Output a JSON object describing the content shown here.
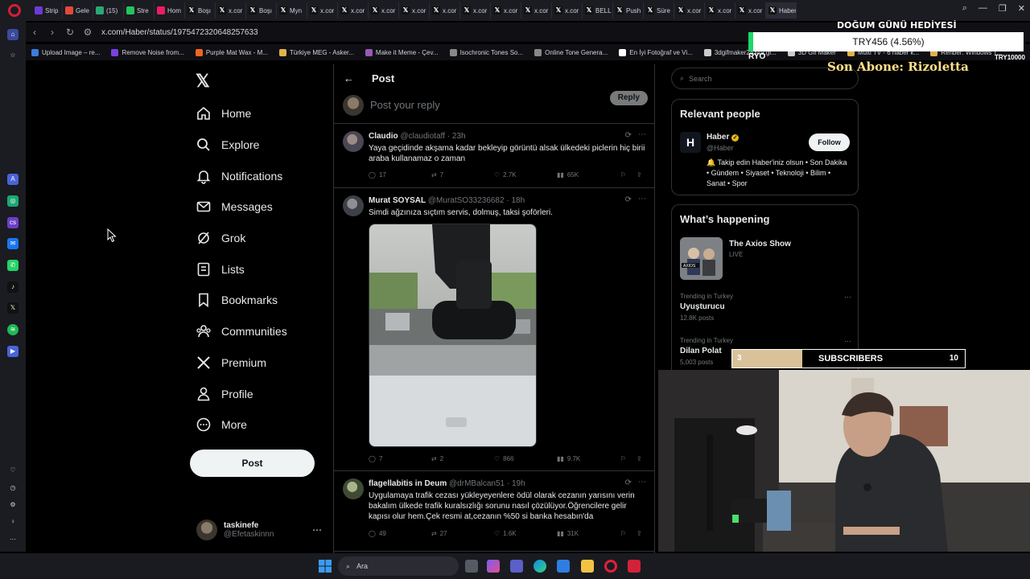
{
  "browser": {
    "tabs": [
      {
        "label": "Strip",
        "color": "#6c3bd6"
      },
      {
        "label": "Gele",
        "color": "#e3493a"
      },
      {
        "label": "(15)",
        "color": "#2aa876"
      },
      {
        "label": "Stre",
        "color": "#22c55e"
      },
      {
        "label": "Hom",
        "color": "#e91e63"
      },
      {
        "label": "Boşı",
        "color": "#111111"
      },
      {
        "label": "x.cor",
        "color": "#111111"
      },
      {
        "label": "Boşı",
        "color": "#111111"
      },
      {
        "label": "Myn",
        "color": "#111111"
      },
      {
        "label": "x.cor",
        "color": "#111111"
      },
      {
        "label": "x.cor",
        "color": "#111111"
      },
      {
        "label": "x.cor",
        "color": "#111111"
      },
      {
        "label": "x.cor",
        "color": "#111111"
      },
      {
        "label": "x.cor",
        "color": "#111111"
      },
      {
        "label": "x.cor",
        "color": "#111111"
      },
      {
        "label": "x.cor",
        "color": "#111111"
      },
      {
        "label": "x.cor",
        "color": "#111111"
      },
      {
        "label": "x.cor",
        "color": "#111111"
      },
      {
        "label": "BELL",
        "color": "#111111"
      },
      {
        "label": "Push",
        "color": "#111111"
      },
      {
        "label": "Süre",
        "color": "#111111"
      },
      {
        "label": "x.cor",
        "color": "#111111"
      },
      {
        "label": "x.cor",
        "color": "#111111"
      },
      {
        "label": "x.cor",
        "color": "#111111"
      },
      {
        "label": "Haber o",
        "color": "#111111"
      }
    ],
    "url": "x.com/Haber/status/1975472320648257633",
    "bookmarks": [
      {
        "label": "Upload Image – re...",
        "color": "#3d7be0"
      },
      {
        "label": "Remove Noise from...",
        "color": "#7b3fe4"
      },
      {
        "label": "Purple Mat Wax - M...",
        "color": "#f26522"
      },
      {
        "label": "Türkiye MEG - Asker...",
        "color": "#e0b34a"
      },
      {
        "label": "Make it Meme - Çev...",
        "color": "#9b59b6"
      },
      {
        "label": "Isochronic Tones So...",
        "color": "#888888"
      },
      {
        "label": "Online Tone Genera...",
        "color": "#888888"
      },
      {
        "label": "En İyi Fotoğraf ve Vi...",
        "color": "#ffffff"
      },
      {
        "label": "3dgifmaker28349.gi...",
        "color": "#cccccc"
      },
      {
        "label": "3D Gif Maker",
        "color": "#cccccc"
      },
      {
        "label": "Multi TV - 6 haber k...",
        "color": "#e0b34a"
      },
      {
        "label": "Rehber: Windows T...",
        "color": "#e0b34a"
      }
    ]
  },
  "nav": {
    "items": [
      {
        "label": "Home",
        "icon": "home-icon"
      },
      {
        "label": "Explore",
        "icon": "search-icon"
      },
      {
        "label": "Notifications",
        "icon": "bell-icon"
      },
      {
        "label": "Messages",
        "icon": "mail-icon"
      },
      {
        "label": "Grok",
        "icon": "grok-icon"
      },
      {
        "label": "Lists",
        "icon": "list-icon"
      },
      {
        "label": "Bookmarks",
        "icon": "bookmark-icon"
      },
      {
        "label": "Communities",
        "icon": "people-icon"
      },
      {
        "label": "Premium",
        "icon": "x-icon"
      },
      {
        "label": "Profile",
        "icon": "person-icon"
      },
      {
        "label": "More",
        "icon": "more-circle-icon"
      }
    ],
    "post_label": "Post",
    "user": {
      "name": "taskinefe",
      "handle": "@Efetaskinnn"
    }
  },
  "main": {
    "title": "Post",
    "reply_placeholder": "Post your reply",
    "reply_label": "Reply",
    "tweets": [
      {
        "name": "Claudio",
        "handle": "@claudiotaff",
        "time": "23h",
        "text": "Yaya geçidinde akşama kadar bekleyip görüntü alsak ülkedeki piclerin hiç birii araba kullanamaz o zaman",
        "replies": "17",
        "reposts": "7",
        "likes": "2.7K",
        "views": "65K"
      },
      {
        "name": "Murat SOYSAL",
        "handle": "@MuratSO33236682",
        "time": "18h",
        "text": "Simdi ağzınıza sıçtım servis, dolmuş, taksi şoförleri.",
        "replies": "7",
        "reposts": "2",
        "likes": "866",
        "views": "9.7K"
      },
      {
        "name": "flagellabitis in Deum",
        "handle": "@drMBalcan51",
        "time": "19h",
        "text": "Uygulamaya trafik cezası yükleyeyenlere ödül olarak cezanın yarısını verin bakalım ülkede trafik kuralsızlığı sorunu nasıl çözülüyor.Öğrencilere gelir kapısı olur hem.Çek resmi at,cezanın %50 si banka hesabın'da",
        "replies": "49",
        "reposts": "27",
        "likes": "1.6K",
        "views": "31K"
      }
    ]
  },
  "sidebar": {
    "search_placeholder": "Search",
    "relevant_title": "Relevant people",
    "person": {
      "name": "Haber",
      "handle": "@Haber",
      "follow_label": "Follow",
      "bio": "🔔 Takip edin Haber'iniz olsun • Son Dakika • Gündem • Siyaset • Teknoloji • Bilim • Sanat • Spor"
    },
    "happening_title": "What’s happening",
    "show": {
      "title": "The Axios Show",
      "status": "LIVE"
    },
    "trends": [
      {
        "context": "Trending in Turkey",
        "name": "Uyuşturucu",
        "count": "12.8K posts"
      },
      {
        "context": "Trending in Turkey",
        "name": "Dilan Polat",
        "count": "5,003 posts"
      }
    ]
  },
  "overlay": {
    "birthday": "DOĞUM GÜNÜ HEDİYESİ",
    "try_progress": "TRY456 (4.56%)",
    "ryo": "RYO",
    "try_goal": "TRY10000",
    "last_sub": "Son Abone: Rizoletta",
    "sub_current": "3",
    "sub_label": "SUBSCRIBERS",
    "sub_goal": "10",
    "sub_progress_fraction": 0.3
  },
  "taskbar": {
    "search_label": "Ara"
  }
}
